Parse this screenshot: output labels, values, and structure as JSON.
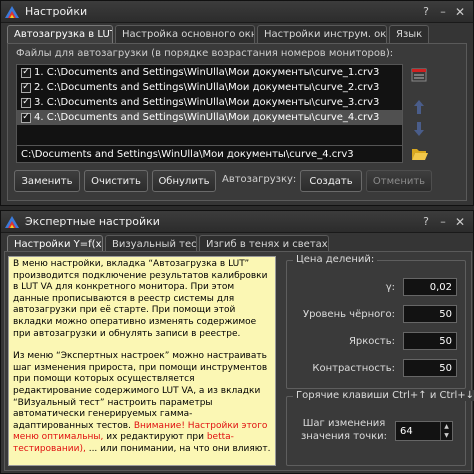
{
  "top_window": {
    "title": "Настройки",
    "tabs": [
      {
        "label": "Автозагрузка в LUT",
        "active": true
      },
      {
        "label": "Настройка основного окна",
        "active": false
      },
      {
        "label": "Настройки инструм. окон",
        "active": false
      },
      {
        "label": "Язык",
        "active": false
      }
    ],
    "list_caption": "Файлы для автозагрузки (в порядке  возрастания номеров мониторов):",
    "files": [
      {
        "label": "1. C:\\Documents and Settings\\WinUlla\\Мои документы\\curve_1.crv3",
        "checked": true,
        "selected": false
      },
      {
        "label": "2. C:\\Documents and Settings\\WinUlla\\Мои документы\\curve_2.crv3",
        "checked": true,
        "selected": false
      },
      {
        "label": "3. C:\\Documents and Settings\\WinUlla\\Мои документы\\curve_3.crv3",
        "checked": true,
        "selected": false
      },
      {
        "label": "4. C:\\Documents and Settings\\WinUlla\\Мои документы\\curve_4.crv3",
        "checked": true,
        "selected": true
      }
    ],
    "path": "C:\\Documents and Settings\\WinUlla\\Мои документы\\curve_4.crv3",
    "buttons": {
      "replace": "Заменить",
      "clear": "Очистить",
      "reset": "Обнулить",
      "autoload_label": "Автозагрузку:",
      "create": "Создать",
      "cancel": "Отменить"
    }
  },
  "bottom_window": {
    "title": "Экспертные настройки",
    "tabs": [
      {
        "label": "Настройки Y=f(x)",
        "active": true
      },
      {
        "label": "Визуальный тест",
        "active": false
      },
      {
        "label": "Изгиб в тенях и светах",
        "active": false
      }
    ],
    "info": {
      "p1": "В меню настройки, вкладка “Автозагрузка в LUT” производится подключение результатов калибровки в LUT VA для конкретного монитора. При этом данные прописываются в реестр системы для автозагрузки при её старте. При помощи этой вкладки можно оперативно изменять содержимое при автозагрузки и обнулять записи в реестре.",
      "p2_start": "Из меню “Экспертных настроек” можно настраивать шаг изменения прироста, при помощи инструментов при помощи которых осуществляется редактирование содержимого LUT VA, а из вкладки “ВИзуальный тест” настроить параметры автоматически генерируемых гамма-адаптированных тестов.",
      "p2_red1": "Внимание! Настройки этого меню оптимальны,",
      "p2_mid": "их редактируют при",
      "p2_red2": "betta-тестировании),",
      "p2_end": "... или понимании, на что они влияют."
    },
    "price_group": {
      "title": "Цена делений:",
      "fields": [
        {
          "label": "γ:",
          "value": "0,02"
        },
        {
          "label": "Уровень чёрного:",
          "value": "50"
        },
        {
          "label": "Яркость:",
          "value": "50"
        },
        {
          "label": "Контрастность:",
          "value": "50"
        }
      ]
    },
    "hotkey_group": {
      "title": "Горячие клавиши Ctrl+↑ и Ctrl+↓",
      "label_line1": "Шаг изменения",
      "label_line2": "значения точки:",
      "value": "64"
    }
  },
  "colors": {
    "window_bg": "#353535",
    "field_bg": "#121212",
    "info_bg": "#fbf7b4",
    "warning_red": "#e01010"
  }
}
